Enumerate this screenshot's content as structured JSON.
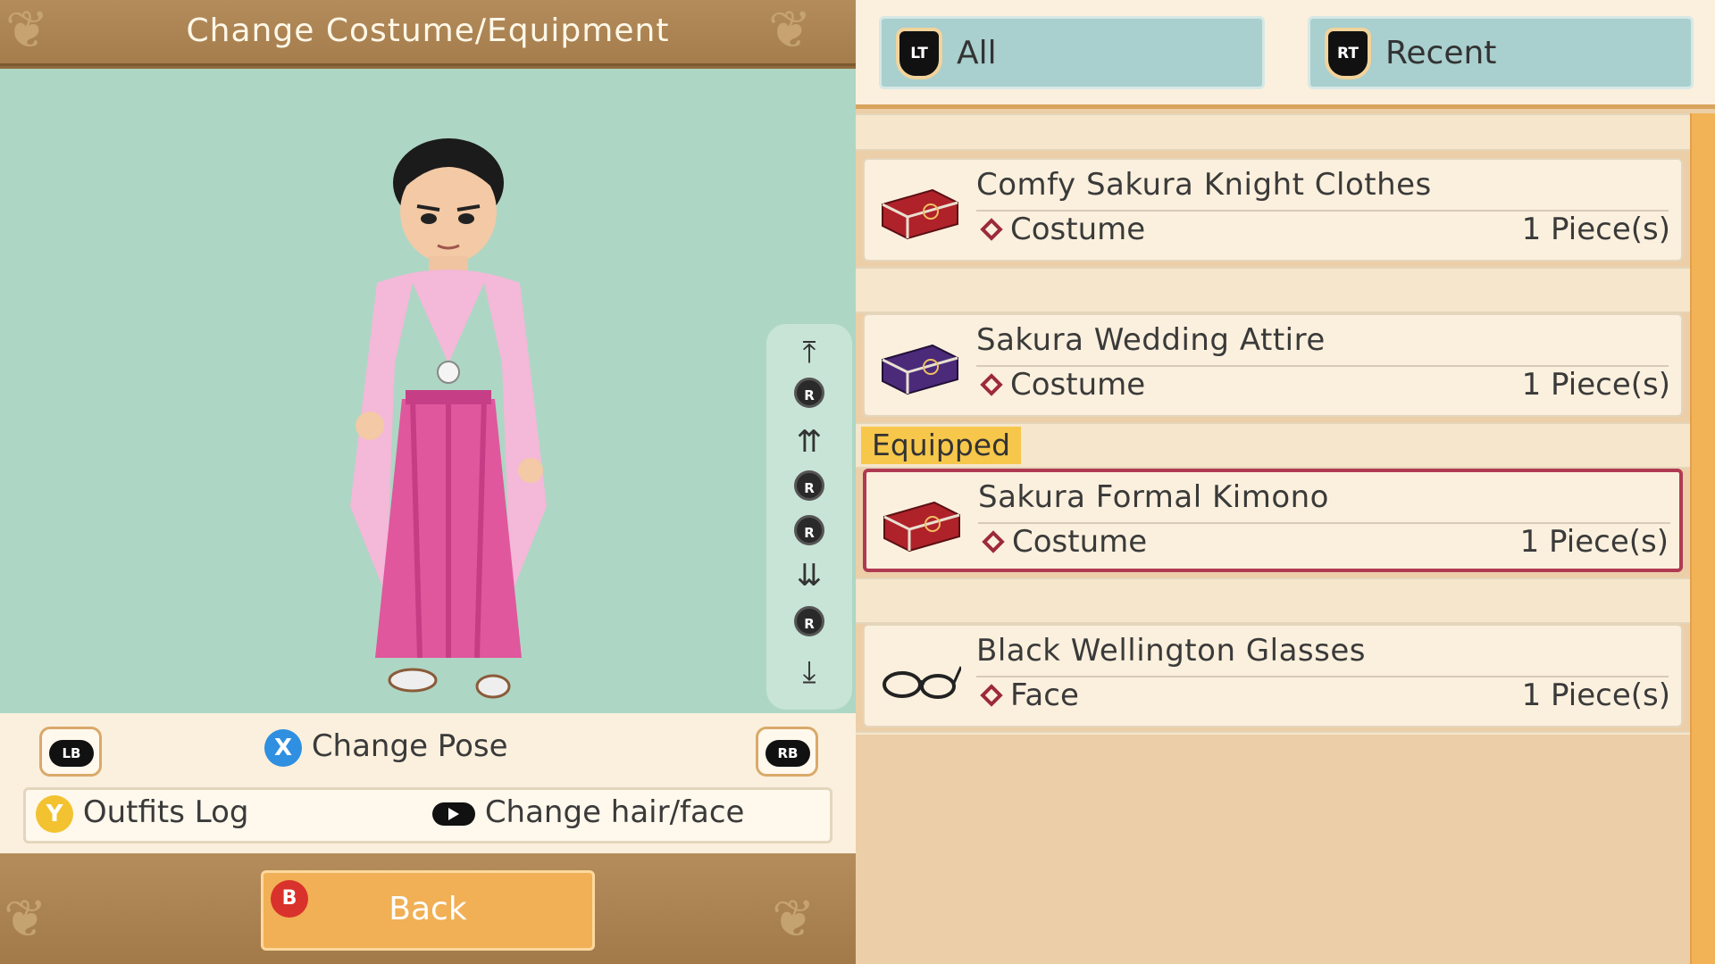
{
  "window": {
    "title": "Change Costume/Equipment"
  },
  "controls": {
    "lb": "LB",
    "rb": "RB",
    "change_pose": {
      "button": "X",
      "label": "Change Pose"
    },
    "outfits_log": {
      "button": "Y",
      "label": "Outfits Log"
    },
    "change_hair_face": {
      "label": "Change hair/face"
    },
    "back": {
      "button": "B",
      "label": "Back"
    }
  },
  "camera_controls": {
    "knob": "R",
    "items": [
      "zoom-out-max-icon",
      "r-up-icon",
      "zoom-in-icon",
      "r-left-icon",
      "r-right-icon",
      "zoom-out-icon",
      "r-down-icon",
      "zoom-in-max-icon"
    ]
  },
  "tabs": [
    {
      "button": "LT",
      "label": "All"
    },
    {
      "button": "RT",
      "label": "Recent"
    }
  ],
  "equipped_label": "Equipped",
  "items": [
    {
      "name": "Comfy Sakura Knight Clothes",
      "type": "Costume",
      "qty": "1 Piece(s)",
      "icon": "red-chest-icon",
      "color": "#b0222a"
    },
    {
      "name": "Sakura Wedding Attire",
      "type": "Costume",
      "qty": "1 Piece(s)",
      "icon": "purple-chest-icon",
      "color": "#4b2a7a"
    },
    {
      "name": "Sakura Formal Kimono",
      "type": "Costume",
      "qty": "1 Piece(s)",
      "icon": "red-chest-icon",
      "color": "#b0222a",
      "equipped": true
    },
    {
      "name": "Black Wellington Glasses",
      "type": "Face",
      "qty": "1 Piece(s)",
      "icon": "glasses-icon",
      "color": "#222222"
    }
  ],
  "colors": {
    "accent": "#f1b055",
    "selected_border": "#b03a52",
    "stage": "#aed6c4",
    "tab": "#a9cfce"
  }
}
